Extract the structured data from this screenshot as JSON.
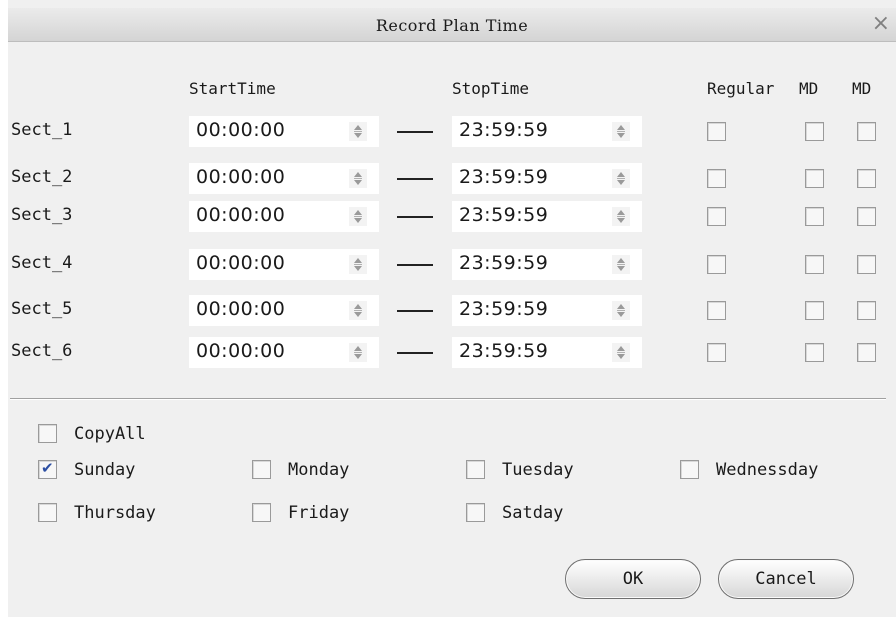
{
  "dialog": {
    "title": "Record Plan Time",
    "close_glyph": "×"
  },
  "headers": {
    "start": "StartTime",
    "stop": "StopTime",
    "regular": "Regular",
    "md1": "MD",
    "md2": "MD"
  },
  "separator": "——",
  "sections": [
    {
      "label": "Sect_1",
      "start": "00:00:00",
      "stop": "23:59:59",
      "regular": false,
      "md1": false,
      "md2": false
    },
    {
      "label": "Sect_2",
      "start": "00:00:00",
      "stop": "23:59:59",
      "regular": false,
      "md1": false,
      "md2": false
    },
    {
      "label": "Sect_3",
      "start": "00:00:00",
      "stop": "23:59:59",
      "regular": false,
      "md1": false,
      "md2": false
    },
    {
      "label": "Sect_4",
      "start": "00:00:00",
      "stop": "23:59:59",
      "regular": false,
      "md1": false,
      "md2": false
    },
    {
      "label": "Sect_5",
      "start": "00:00:00",
      "stop": "23:59:59",
      "regular": false,
      "md1": false,
      "md2": false
    },
    {
      "label": "Sect_6",
      "start": "00:00:00",
      "stop": "23:59:59",
      "regular": false,
      "md1": false,
      "md2": false
    }
  ],
  "copy_all": {
    "label": "CopyAll",
    "checked": false
  },
  "days": [
    {
      "label": "Sunday",
      "checked": true
    },
    {
      "label": "Monday",
      "checked": false
    },
    {
      "label": "Tuesday",
      "checked": false
    },
    {
      "label": "Wednessday",
      "checked": false
    },
    {
      "label": "Thursday",
      "checked": false
    },
    {
      "label": "Friday",
      "checked": false
    },
    {
      "label": "Satday",
      "checked": false
    }
  ],
  "buttons": {
    "ok": "OK",
    "cancel": "Cancel"
  },
  "colors": {
    "check_mark": "#2d4fa3",
    "dialog_bg": "#f0f0f0",
    "titlebar": "#d4d4d4"
  }
}
